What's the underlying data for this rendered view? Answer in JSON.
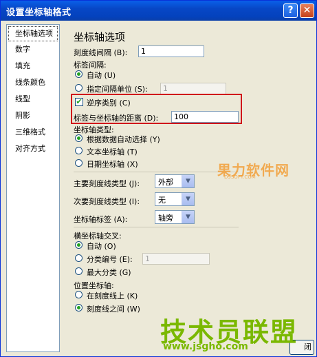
{
  "window": {
    "title": "设置坐标轴格式",
    "help_label": "?",
    "close_label": "✕"
  },
  "nav": {
    "items": [
      "坐标轴选项",
      "数字",
      "填充",
      "线条颜色",
      "线型",
      "阴影",
      "三维格式",
      "对齐方式"
    ]
  },
  "main": {
    "heading": "坐标轴选项",
    "tick_interval": {
      "label": "刻度线间隔 (B):",
      "value": "1"
    },
    "label_interval": {
      "label": "标签间隔:",
      "auto": "自动 (U)",
      "specify": "指定间隔单位 (S):",
      "specify_value": "1"
    },
    "reverse": {
      "label": "逆序类别 (C)",
      "checked": true
    },
    "label_distance": {
      "label": "标签与坐标轴的距离 (D):",
      "value": "100"
    },
    "axis_type": {
      "label": "坐标轴类型:",
      "options": [
        "根据数据自动选择 (Y)",
        "文本坐标轴 (T)",
        "日期坐标轴 (X)"
      ]
    },
    "major_tick": {
      "label": "主要刻度线类型 (J):",
      "value": "外部"
    },
    "minor_tick": {
      "label": "次要刻度线类型 (I):",
      "value": "无"
    },
    "axis_labels": {
      "label": "坐标轴标签 (A):",
      "value": "轴旁"
    },
    "cross": {
      "label": "横坐标轴交叉:",
      "auto": "自动 (O)",
      "category_no": "分类编号 (E):",
      "category_value": "1",
      "max": "最大分类 (G)"
    },
    "position": {
      "label": "位置坐标轴:",
      "on_tick": "在刻度线上 (K)",
      "between": "刻度线之间 (W)"
    }
  },
  "footer": {
    "close_label": "闭"
  },
  "watermark": {
    "top": "果力软件网",
    "top_sub": "D9SOFT.COM",
    "bottom": "技术员联盟",
    "bottom_sub": "www.jsgho.com"
  }
}
